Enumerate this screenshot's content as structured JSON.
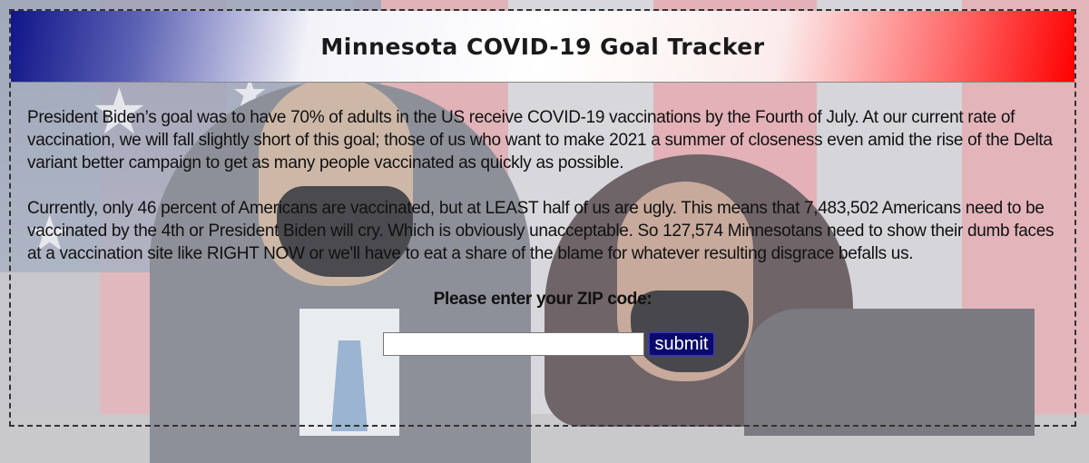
{
  "header": {
    "title": "Minnesota COVID-19 Goal Tracker"
  },
  "content": {
    "paragraph1": "President Biden’s goal was to have 70% of adults in the US receive COVID-19 vaccinations by the Fourth of July. At our current rate of vaccination, we will fall slightly short of this goal; those of us who want to make 2021 a summer of closeness even amid the rise of the Delta variant better campaign to get as many people vaccinated as quickly as possible.",
    "paragraph2": "Currently, only 46 percent of Americans are vaccinated, but at LEAST half of us are ugly. This means that 7,483,502 Americans need to be vaccinated by the 4th or President Biden will cry. Which is obviously unacceptable. So 127,574 Minnesotans need to show their dumb faces at a vaccination site like RIGHT NOW or we'll have to eat a share of the blame for whatever resulting disgrace befalls us."
  },
  "form": {
    "zip_label": "Please enter your ZIP code:",
    "zip_value": "",
    "submit_label": "submit"
  },
  "colors": {
    "header_blue": "#10158a",
    "header_red": "#ff0000",
    "button_bg": "#0a0a6e"
  }
}
